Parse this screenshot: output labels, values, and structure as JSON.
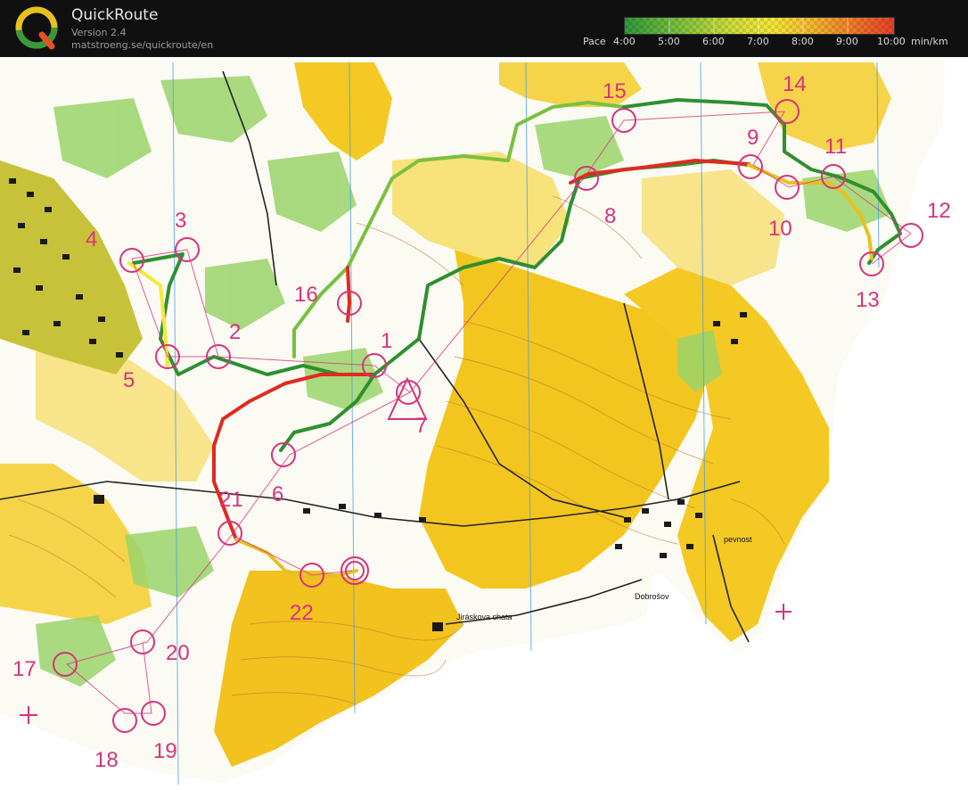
{
  "app": {
    "title": "QuickRoute",
    "version": "Version 2.4",
    "url": "matstroeng.se/quickroute/en",
    "logo_letter": "Q"
  },
  "legend": {
    "label": "Pace",
    "ticks": [
      "4:00",
      "5:00",
      "6:00",
      "7:00",
      "8:00",
      "9:00",
      "10:00"
    ],
    "unit": "min/km",
    "colors": [
      "#3aa63a",
      "#78c040",
      "#c8dc3c",
      "#f6e83a",
      "#f6b830",
      "#f07a2a",
      "#e8402c"
    ]
  },
  "map": {
    "controls": [
      "1",
      "2",
      "3",
      "4",
      "5",
      "6",
      "7",
      "8",
      "9",
      "10",
      "11",
      "12",
      "13",
      "14",
      "15",
      "16",
      "17",
      "18",
      "19",
      "20",
      "21",
      "22"
    ],
    "place_names": [
      "Jiráskova chata",
      "Dobrošov",
      "pevnost"
    ],
    "colors": {
      "control": "#d6337e",
      "yellow": "#f2c21f",
      "light_yellow": "#f8e27a",
      "green": "#8ecf60",
      "route_fast": "#2f8f2f",
      "route_slow": "#e02a20"
    }
  }
}
